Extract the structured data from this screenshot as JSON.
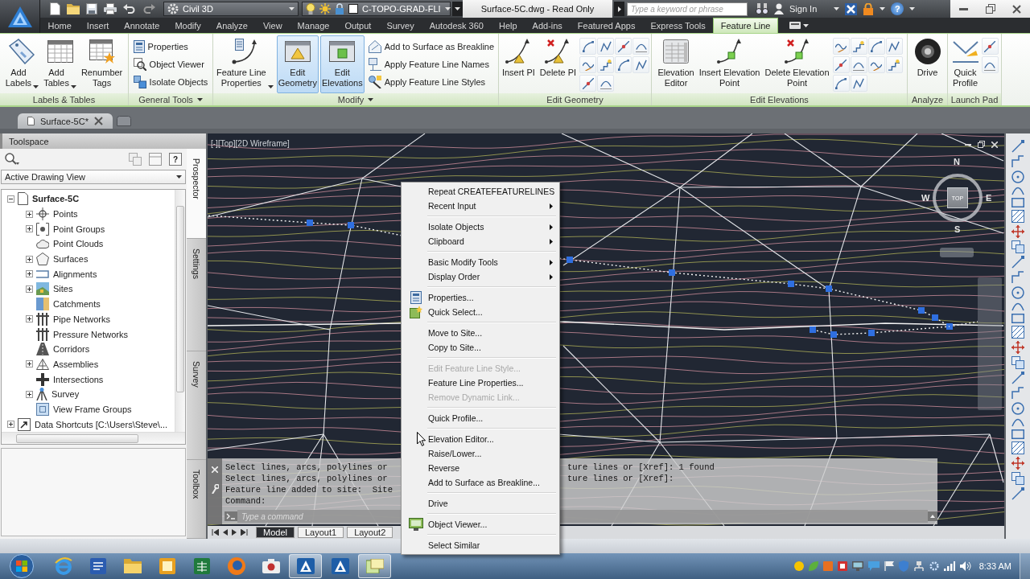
{
  "title_bar": {
    "workspace": "Civil 3D",
    "layer": "C-TOPO-GRAD-FLI",
    "title": "Surface-5C.dwg - Read Only",
    "search": {
      "placeholder": "Type a keyword or phrase"
    },
    "sign_in": "Sign In",
    "help": "?"
  },
  "ribbon_tabs": [
    {
      "label": "Home",
      "selected": false
    },
    {
      "label": "Insert",
      "selected": false
    },
    {
      "label": "Annotate",
      "selected": false
    },
    {
      "label": "Modify",
      "selected": false
    },
    {
      "label": "Analyze",
      "selected": false
    },
    {
      "label": "View",
      "selected": false
    },
    {
      "label": "Manage",
      "selected": false
    },
    {
      "label": "Output",
      "selected": false
    },
    {
      "label": "Survey",
      "selected": false
    },
    {
      "label": "Autodesk 360",
      "selected": false
    },
    {
      "label": "Help",
      "selected": false
    },
    {
      "label": "Add-ins",
      "selected": false
    },
    {
      "label": "Featured Apps",
      "selected": false
    },
    {
      "label": "Express Tools",
      "selected": false
    },
    {
      "label": "Feature Line",
      "selected": true
    }
  ],
  "ribbon_panels": [
    {
      "label": "Labels & Tables",
      "menu": false,
      "items": [
        {
          "kind": "large",
          "label": "Add\nLabels",
          "dropdown": true,
          "selected": false
        },
        {
          "kind": "large",
          "label": "Add\nTables",
          "dropdown": true,
          "selected": false
        },
        {
          "kind": "large",
          "label": "Renumber\nTags",
          "dropdown": false,
          "selected": false
        }
      ]
    },
    {
      "label": "General Tools",
      "menu": true,
      "items": [
        {
          "kind": "small",
          "label": "Properties",
          "selected": false
        },
        {
          "kind": "small",
          "label": "Object Viewer",
          "selected": false
        },
        {
          "kind": "small",
          "label": "Isolate Objects",
          "selected": false
        }
      ]
    },
    {
      "label": "Modify",
      "menu": true,
      "items": [
        {
          "kind": "large",
          "label": "Feature Line\nProperties",
          "dropdown": true,
          "selected": false
        },
        {
          "kind": "large",
          "label": "Edit\nGeometry",
          "dropdown": false,
          "selected": true
        },
        {
          "kind": "large",
          "label": "Edit\nElevations",
          "dropdown": false,
          "selected": true
        },
        {
          "kind": "small",
          "label": "Add to Surface as Breakline",
          "selected": false
        },
        {
          "kind": "small",
          "label": "Apply Feature Line Names",
          "selected": false
        },
        {
          "kind": "small",
          "label": "Apply Feature Line Styles",
          "selected": false
        }
      ]
    },
    {
      "label": "Edit Geometry",
      "menu": false,
      "items": [
        {
          "kind": "large",
          "label": "Insert PI",
          "dropdown": false,
          "selected": false
        },
        {
          "kind": "large",
          "label": "Delete PI",
          "dropdown": false,
          "selected": false
        },
        {
          "kind": "icon",
          "selected": false
        },
        {
          "kind": "icon",
          "selected": false
        },
        {
          "kind": "icon",
          "selected": false
        },
        {
          "kind": "icon",
          "selected": false
        },
        {
          "kind": "icon",
          "selected": false
        },
        {
          "kind": "icon",
          "selected": false
        },
        {
          "kind": "icon",
          "selected": false
        },
        {
          "kind": "icon",
          "selected": false
        },
        {
          "kind": "icon",
          "selected": false
        },
        {
          "kind": "icon",
          "selected": false
        }
      ]
    },
    {
      "label": "Edit Elevations",
      "menu": false,
      "items": [
        {
          "kind": "large",
          "label": "Elevation\nEditor",
          "dropdown": false,
          "selected": false
        },
        {
          "kind": "large",
          "label": "Insert Elevation\nPoint",
          "dropdown": false,
          "selected": false
        },
        {
          "kind": "large",
          "label": "Delete Elevation\nPoint",
          "dropdown": false,
          "selected": false
        },
        {
          "kind": "icon",
          "selected": false
        },
        {
          "kind": "icon",
          "selected": false
        },
        {
          "kind": "icon",
          "selected": false
        },
        {
          "kind": "icon",
          "selected": false
        },
        {
          "kind": "icon",
          "selected": false
        },
        {
          "kind": "icon",
          "selected": false
        },
        {
          "kind": "icon",
          "selected": false
        },
        {
          "kind": "icon",
          "selected": false
        },
        {
          "kind": "icon",
          "selected": false
        },
        {
          "kind": "icon",
          "selected": false
        }
      ]
    },
    {
      "label": "Analyze",
      "menu": false,
      "items": [
        {
          "kind": "large",
          "label": "Drive",
          "dropdown": false,
          "selected": false
        }
      ]
    },
    {
      "label": "Launch Pad",
      "menu": false,
      "items": [
        {
          "kind": "large",
          "label": "Quick\nProfile",
          "dropdown": false,
          "selected": false
        },
        {
          "kind": "icon",
          "selected": false
        },
        {
          "kind": "icon",
          "selected": false
        }
      ]
    }
  ],
  "doc_tabs": [
    {
      "label": "Surface-5C*",
      "selected": true
    }
  ],
  "toolspace": {
    "title": "Toolspace",
    "help": "?",
    "view": "Active Drawing View",
    "tree": [
      {
        "label": "Surface-5C",
        "current": true,
        "expandable": true,
        "expanded": true,
        "children": [
          {
            "label": "Points",
            "expandable": true
          },
          {
            "label": "Point Groups",
            "expandable": true
          },
          {
            "label": "Point Clouds",
            "expandable": false
          },
          {
            "label": "Surfaces",
            "expandable": true
          },
          {
            "label": "Alignments",
            "expandable": true
          },
          {
            "label": "Sites",
            "expandable": true
          },
          {
            "label": "Catchments",
            "expandable": false
          },
          {
            "label": "Pipe Networks",
            "expandable": true
          },
          {
            "label": "Pressure Networks",
            "expandable": false
          },
          {
            "label": "Corridors",
            "expandable": false
          },
          {
            "label": "Assemblies",
            "expandable": true
          },
          {
            "label": "Intersections",
            "expandable": false
          },
          {
            "label": "Survey",
            "expandable": true
          },
          {
            "label": "View Frame Groups",
            "expandable": false
          }
        ]
      },
      {
        "label": "Data Shortcuts [C:\\Users\\Steve\\...",
        "current": false,
        "expandable": true
      }
    ],
    "side_tabs": [
      {
        "label": "Prospector",
        "selected": true
      },
      {
        "label": "Settings",
        "selected": false
      },
      {
        "label": "Survey",
        "selected": false
      },
      {
        "label": "Toolbox",
        "selected": false
      }
    ]
  },
  "viewport": {
    "label": "[-][Top][2D Wireframe]",
    "viewcube": {
      "north": "N",
      "west": "W",
      "east": "E",
      "south": "S",
      "face": "TOP"
    }
  },
  "command_line": {
    "history": [
      {
        "start": "Select lines, arcs, polylines or",
        "end": "ture lines or [Xref]: 1 found"
      },
      {
        "start": "Select lines, arcs, polylines or",
        "end": "ture lines or [Xref]:"
      },
      {
        "start": "Feature line added to site:  Site"
      },
      {
        "start": "Command:"
      }
    ],
    "placeholder": "Type a command"
  },
  "layout_tabs": [
    {
      "label": "Model",
      "selected": true
    },
    {
      "label": "Layout1",
      "selected": false
    },
    {
      "label": "Layout2",
      "selected": false
    }
  ],
  "context_menu": {
    "groups": [
      {
        "items": [
          {
            "label": "Repeat CREATEFEATURELINES",
            "icon": false,
            "submenu": false,
            "disabled": false
          },
          {
            "label": "Recent Input",
            "icon": false,
            "submenu": true,
            "disabled": false
          }
        ]
      },
      {
        "items": [
          {
            "label": "Isolate Objects",
            "icon": false,
            "submenu": true,
            "disabled": false
          },
          {
            "label": "Clipboard",
            "icon": false,
            "submenu": true,
            "disabled": false
          }
        ]
      },
      {
        "items": [
          {
            "label": "Basic Modify Tools",
            "icon": false,
            "submenu": true,
            "disabled": false
          },
          {
            "label": "Display Order",
            "icon": false,
            "submenu": true,
            "disabled": false
          }
        ]
      },
      {
        "items": [
          {
            "label": "Properties...",
            "icon": true,
            "submenu": false,
            "disabled": false
          },
          {
            "label": "Quick Select...",
            "icon": true,
            "submenu": false,
            "disabled": false
          }
        ]
      },
      {
        "items": [
          {
            "label": "Move to Site...",
            "icon": false,
            "submenu": false,
            "disabled": false
          },
          {
            "label": "Copy to Site...",
            "icon": false,
            "submenu": false,
            "disabled": false
          }
        ]
      },
      {
        "items": [
          {
            "label": "Edit Feature Line Style...",
            "icon": false,
            "submenu": false,
            "disabled": true
          },
          {
            "label": "Feature Line Properties...",
            "icon": false,
            "submenu": false,
            "disabled": false
          },
          {
            "label": "Remove Dynamic Link...",
            "icon": false,
            "submenu": false,
            "disabled": true
          }
        ]
      },
      {
        "items": [
          {
            "label": "Quick Profile...",
            "icon": false,
            "submenu": false,
            "disabled": false
          }
        ]
      },
      {
        "items": [
          {
            "label": "Elevation Editor...",
            "icon": false,
            "submenu": false,
            "disabled": false
          },
          {
            "label": "Raise/Lower...",
            "icon": false,
            "submenu": false,
            "disabled": false
          },
          {
            "label": "Reverse",
            "icon": false,
            "submenu": false,
            "disabled": false
          },
          {
            "label": "Add to Surface as Breakline...",
            "icon": false,
            "submenu": false,
            "disabled": false
          }
        ]
      },
      {
        "items": [
          {
            "label": "Drive",
            "icon": false,
            "submenu": false,
            "disabled": false
          }
        ]
      },
      {
        "items": [
          {
            "label": "Object Viewer...",
            "icon": true,
            "submenu": false,
            "disabled": false
          }
        ]
      },
      {
        "items": [
          {
            "label": "Select Similar",
            "icon": false,
            "submenu": false,
            "disabled": false
          }
        ]
      }
    ]
  },
  "taskbar": {
    "buttons": [
      {
        "selected": false
      },
      {
        "selected": false
      },
      {
        "selected": false
      },
      {
        "selected": false
      },
      {
        "selected": false
      },
      {
        "selected": false
      },
      {
        "selected": false
      },
      {
        "selected": true
      },
      {
        "selected": false
      },
      {
        "selected": true
      }
    ],
    "clock": "8:33 AM"
  }
}
